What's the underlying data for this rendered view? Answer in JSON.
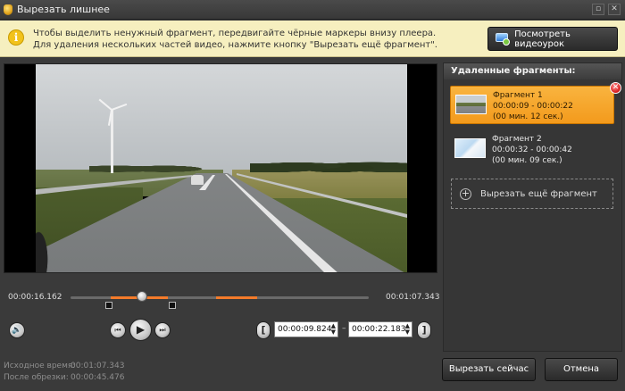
{
  "window": {
    "title": "Вырезать лишнее",
    "restore_glyph": "▫",
    "close_glyph": "✕"
  },
  "infobar": {
    "icon_glyph": "i",
    "line1": "Чтобы выделить ненужный фрагмент, передвигайте чёрные маркеры внизу плеера.",
    "line2": "Для удаления нескольких частей видео, нажмите кнопку \"Вырезать ещё фрагмент\".",
    "lesson_button": "Посмотреть видеоурок"
  },
  "timeline": {
    "current_time": "00:00:16.162",
    "total_time": "00:01:07.343",
    "playhead_fraction": 0.24,
    "segments": [
      {
        "start": 0.134,
        "end": 0.327
      },
      {
        "start": 0.487,
        "end": 0.626
      }
    ]
  },
  "controls": {
    "volume_glyph": "🔊",
    "prev_glyph": "⏮",
    "play_glyph": "▶",
    "next_glyph": "⏭",
    "bracket_start_glyph": "[",
    "bracket_end_glyph": "]",
    "start_value": "00:00:09.824",
    "end_value": "00:00:22.183",
    "dash": "–",
    "spin_arrows": "▲▼"
  },
  "stats": {
    "source_label": "Исходное время:",
    "source_value": "00:01:07.343",
    "after_label": "После обрезки:",
    "after_value": "00:00:45.476"
  },
  "panel": {
    "header": "Удаленные фрагменты:",
    "fragments": [
      {
        "name": "Фрагмент 1",
        "range": "00:00:09 - 00:00:22",
        "duration": "(00 мин. 12 сек.)",
        "selected": true
      },
      {
        "name": "Фрагмент 2",
        "range": "00:00:32 - 00:00:42",
        "duration": "(00 мин. 09 сек.)",
        "selected": false
      }
    ],
    "delete_glyph": "✕",
    "add_plus": "+",
    "add_label": "Вырезать ещё фрагмент"
  },
  "buttons": {
    "cut_now": "Вырезать сейчас",
    "cancel": "Отмена"
  }
}
